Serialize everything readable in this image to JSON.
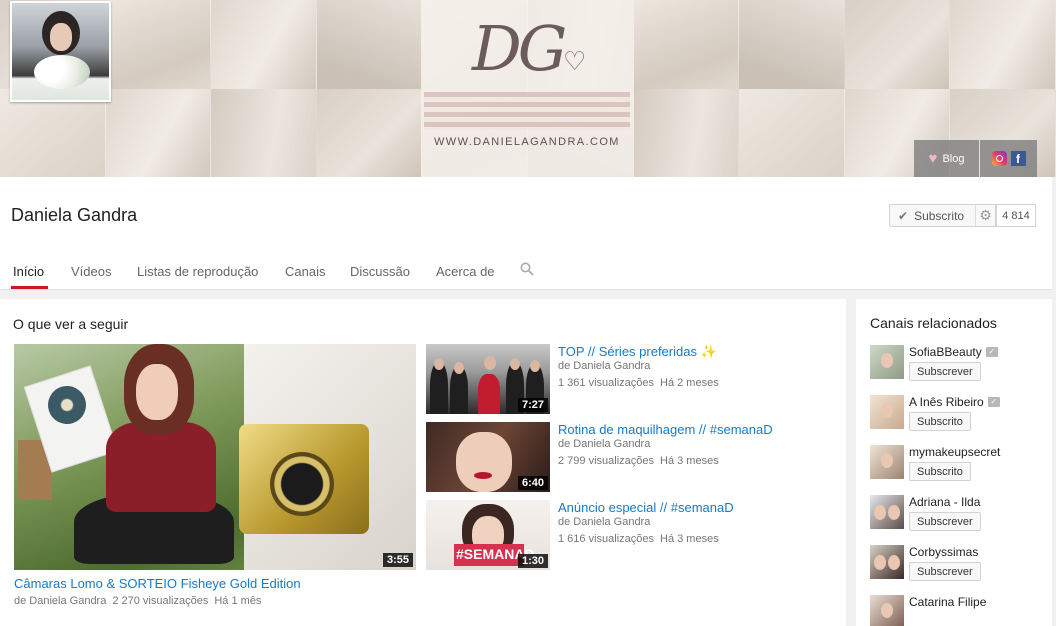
{
  "banner": {
    "logo_text": "DG",
    "logo_url": "WWW.DANIELAGANDRA.COM",
    "blog_label": "Blog"
  },
  "channel": {
    "name": "Daniela Gandra",
    "subscribe_label": "Subscrito",
    "subscriber_count": "4 814"
  },
  "tabs": [
    {
      "label": "Início",
      "active": true
    },
    {
      "label": "Vídeos"
    },
    {
      "label": "Listas de reprodução"
    },
    {
      "label": "Canais"
    },
    {
      "label": "Discussão"
    },
    {
      "label": "Acerca de"
    }
  ],
  "main": {
    "section_title": "O que ver a seguir",
    "featured": {
      "title": "Câmaras Lomo & SORTEIO Fisheye Gold Edition",
      "author": "de Daniela Gandra",
      "views": "2 270 visualizações",
      "age": "Há 1 mês",
      "duration": "3:55"
    },
    "videos": [
      {
        "title": "TOP // Séries preferidas ✨",
        "author": "de Daniela Gandra",
        "views": "1 361 visualizações",
        "age": "Há 2 meses",
        "duration": "7:27"
      },
      {
        "title": "Rotina de maquilhagem // #semanaD",
        "author": "de Daniela Gandra",
        "views": "2 799 visualizações",
        "age": "Há 3 meses",
        "duration": "6:40"
      },
      {
        "title": "Anúncio especial // #semanaD",
        "author": "de Daniela Gandra",
        "views": "1 616 visualizações",
        "age": "Há 3 meses",
        "duration": "1:30",
        "thumb_text": "#SEMANAD"
      }
    ]
  },
  "related": {
    "title": "Canais relacionados",
    "channels": [
      {
        "name": "SofiaBBeauty",
        "verified": true,
        "button": "Subscrever"
      },
      {
        "name": "A Inês Ribeiro",
        "verified": true,
        "button": "Subscrito"
      },
      {
        "name": "mymakeupsecret",
        "verified": false,
        "button": "Subscrito"
      },
      {
        "name": "Adriana - Ilda",
        "verified": false,
        "button": "Subscrever"
      },
      {
        "name": "Corbyssimas",
        "verified": false,
        "button": "Subscrever"
      },
      {
        "name": "Catarina Filipe",
        "verified": false,
        "button": ""
      }
    ]
  },
  "colors": {
    "accent_red": "#cc181e",
    "link_blue": "#167ac6",
    "meta_gray": "#767676"
  }
}
